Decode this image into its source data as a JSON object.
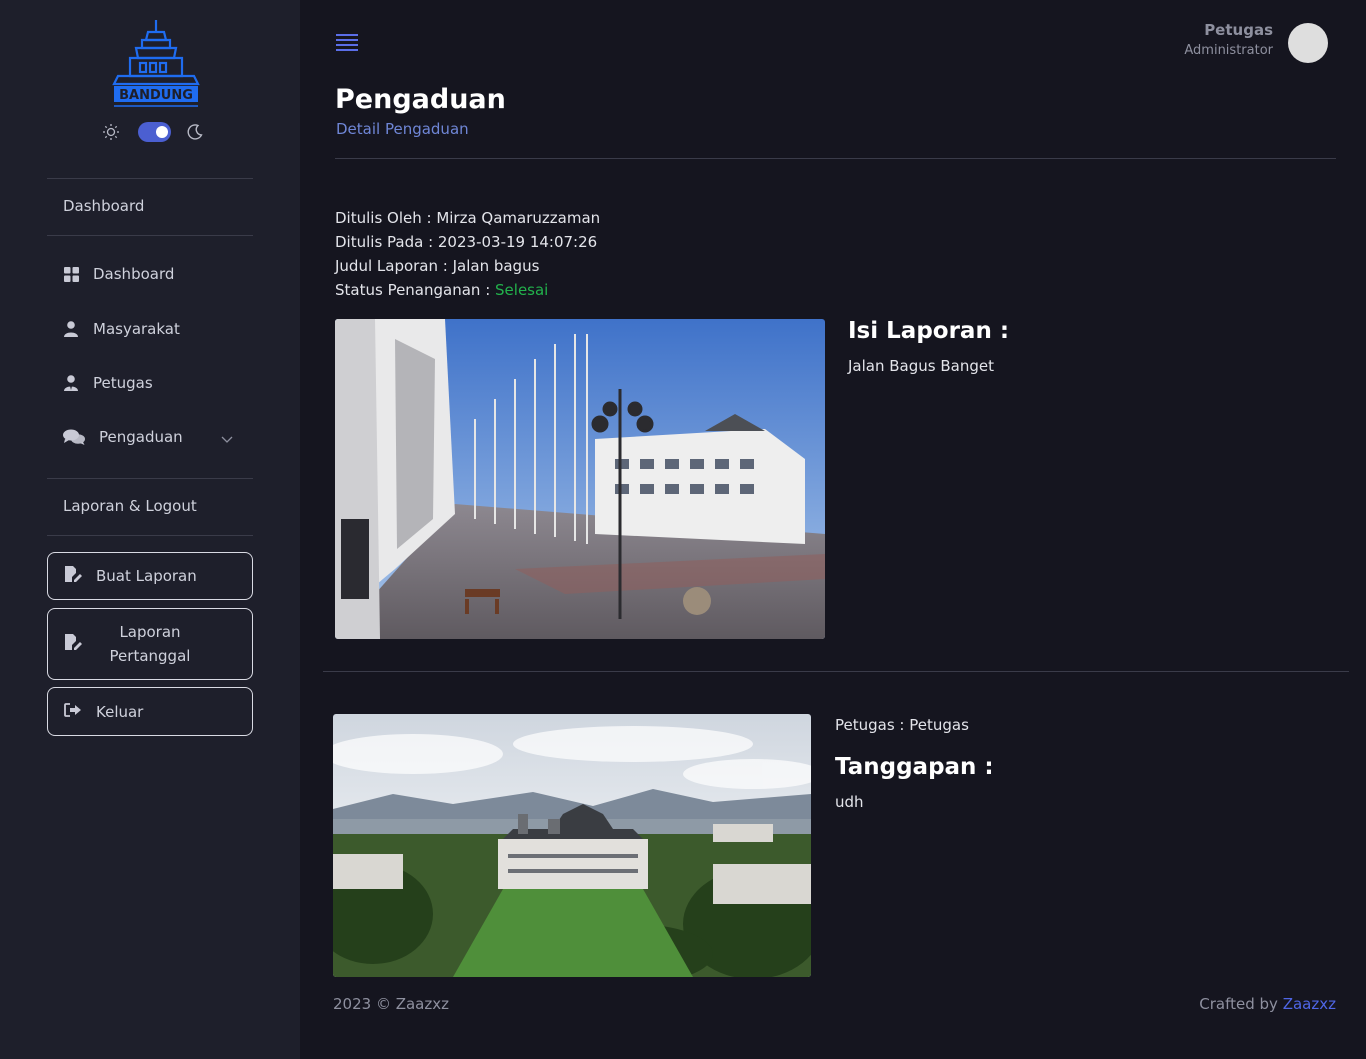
{
  "colors": {
    "accent": "#4f66e6",
    "status_done": "#22b24c",
    "sidebar_bg": "#1e1f2b",
    "main_bg": "#15151f"
  },
  "sidebar": {
    "logo_text": "BANDUNG",
    "section1": "Dashboard",
    "items": [
      {
        "label": "Dashboard",
        "icon": "grid-icon"
      },
      {
        "label": "Masyarakat",
        "icon": "user-icon"
      },
      {
        "label": "Petugas",
        "icon": "user-tie-icon"
      },
      {
        "label": "Pengaduan",
        "icon": "comments-icon"
      }
    ],
    "section2": "Laporan & Logout",
    "buttons": [
      {
        "label": "Buat Laporan",
        "icon": "file-edit-icon"
      },
      {
        "label": "Laporan Pertanggal",
        "icon": "file-edit-icon"
      },
      {
        "label": "Keluar",
        "icon": "logout-icon"
      }
    ]
  },
  "header": {
    "user_name": "Petugas",
    "user_role": "Administrator"
  },
  "page": {
    "title": "Pengaduan",
    "subtitle": "Detail Pengaduan"
  },
  "report": {
    "written_by": "Ditulis Oleh : Mirza Qamaruzzaman",
    "written_at": "Ditulis Pada : 2023-03-19 14:07:26",
    "judul": "Judul Laporan : Jalan bagus",
    "status_label": "Status Penanganan : ",
    "status_value": "Selesai",
    "isi_title": "Isi Laporan :",
    "isi_text": "Jalan Bagus Banget"
  },
  "response": {
    "petugas": "Petugas : Petugas",
    "title": "Tanggapan :",
    "text": "udh"
  },
  "footer": {
    "copyright": "2023 © Zaazxz",
    "crafted_prefix": "Crafted by ",
    "crafted_name": "Zaazxz"
  }
}
